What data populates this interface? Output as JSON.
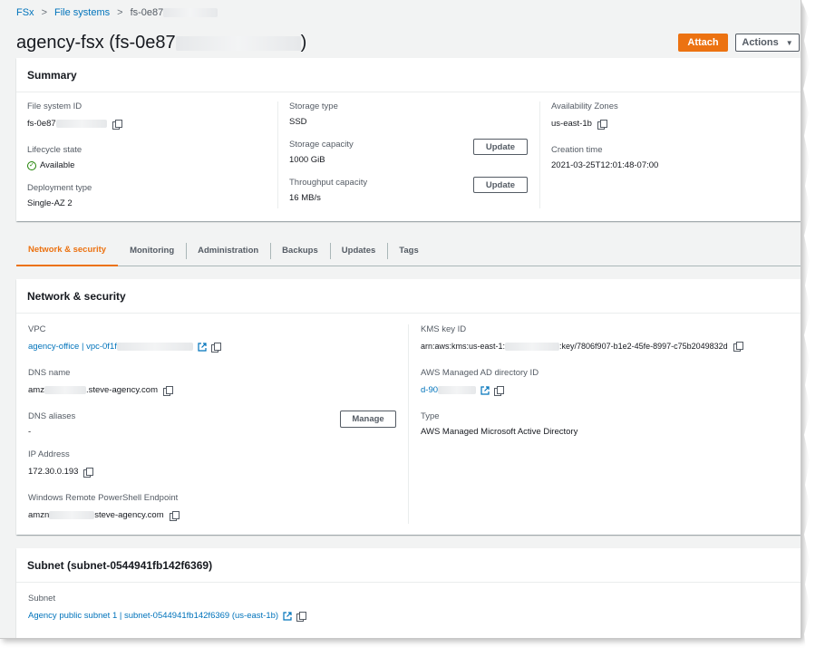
{
  "breadcrumb": {
    "root": "FSx",
    "parent": "File systems",
    "current": "fs-0e87"
  },
  "header": {
    "title": "agency-fsx (fs-0e87",
    "title_suffix": ")",
    "attach_label": "Attach",
    "actions_label": "Actions"
  },
  "summary": {
    "title": "Summary",
    "file_system_id_label": "File system ID",
    "file_system_id_value": "fs-0e87",
    "lifecycle_label": "Lifecycle state",
    "lifecycle_value": "Available",
    "deployment_label": "Deployment type",
    "deployment_value": "Single-AZ 2",
    "storage_type_label": "Storage type",
    "storage_type_value": "SSD",
    "storage_capacity_label": "Storage capacity",
    "storage_capacity_value": "1000 GiB",
    "throughput_label": "Throughput capacity",
    "throughput_value": "16 MB/s",
    "update_label": "Update",
    "az_label": "Availability Zones",
    "az_value": "us-east-1b",
    "creation_label": "Creation time",
    "creation_value": "2021-03-25T12:01:48-07:00"
  },
  "tabs": [
    {
      "label": "Network & security",
      "active": true
    },
    {
      "label": "Monitoring",
      "active": false
    },
    {
      "label": "Administration",
      "active": false
    },
    {
      "label": "Backups",
      "active": false
    },
    {
      "label": "Updates",
      "active": false
    },
    {
      "label": "Tags",
      "active": false
    }
  ],
  "network": {
    "title": "Network & security",
    "vpc_label": "VPC",
    "vpc_value": "agency-office | vpc-0f1f",
    "dns_label": "DNS name",
    "dns_prefix": "amz",
    "dns_suffix": ".steve-agency.com",
    "dns_aliases_label": "DNS aliases",
    "dns_aliases_value": "-",
    "manage_label": "Manage",
    "ip_label": "IP Address",
    "ip_value": "172.30.0.193",
    "ps_label": "Windows Remote PowerShell Endpoint",
    "ps_prefix": "amzn",
    "ps_suffix": "steve-agency.com",
    "kms_label": "KMS key ID",
    "kms_prefix": "arn:aws:kms:us-east-1:",
    "kms_suffix": ":key/7806f907-b1e2-45fe-8997-c75b2049832d",
    "ad_label": "AWS Managed AD directory ID",
    "ad_value": "d-90",
    "type_label": "Type",
    "type_value": "AWS Managed Microsoft Active Directory"
  },
  "subnet": {
    "title": "Subnet (subnet-0544941fb142f6369)",
    "label": "Subnet",
    "value": "Agency public subnet 1 | subnet-0544941fb142f6369 (us-east-1b)"
  },
  "colors": {
    "accent": "#ec7211",
    "link": "#0073bb",
    "success": "#1d8102"
  }
}
